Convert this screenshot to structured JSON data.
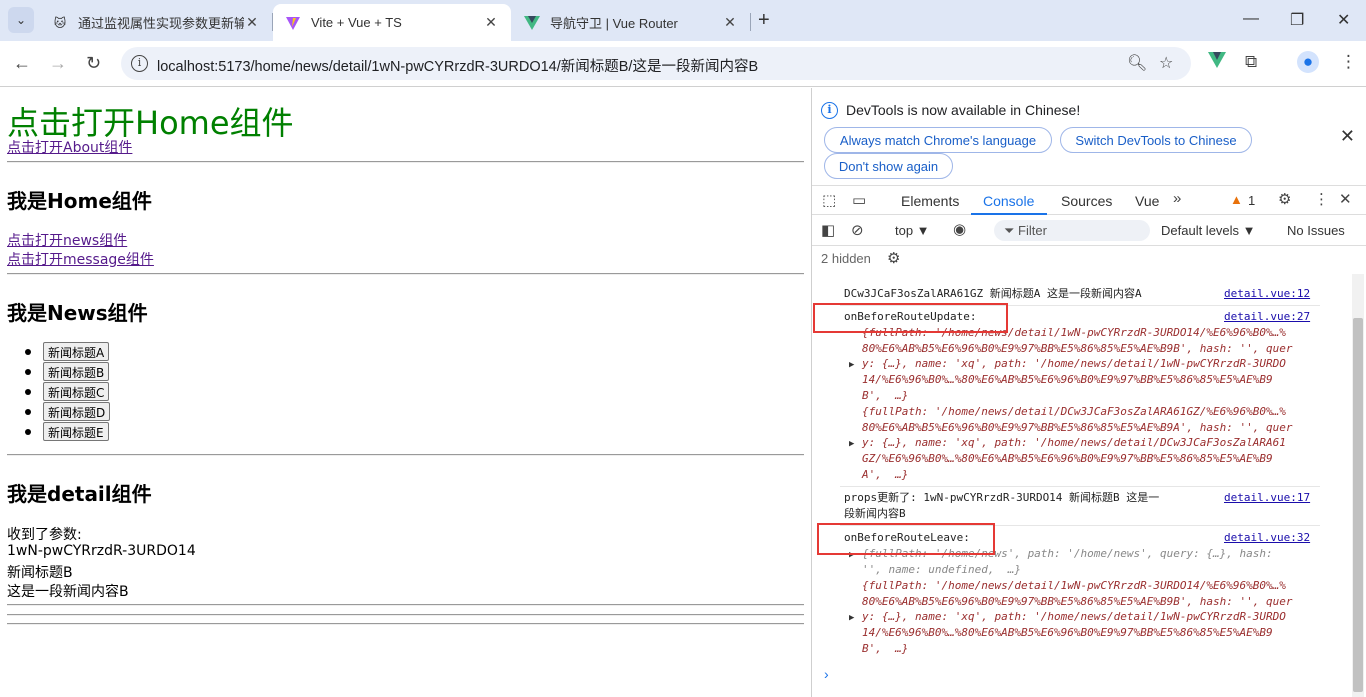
{
  "browser": {
    "tabs": [
      {
        "title": "通过监视属性实现参数更新输出",
        "icon": "chinese-site-favicon",
        "active": false
      },
      {
        "title": "Vite + Vue + TS",
        "icon": "vite-favicon",
        "active": true
      },
      {
        "title": "导航守卫 | Vue Router",
        "icon": "vue-favicon",
        "active": false
      }
    ],
    "url": "localhost:5173/home/news/detail/1wN-pwCYRrzdR-3URDO14/新闻标题B/这是一段新闻内容B"
  },
  "page": {
    "home_link_heading": "点击打开Home组件",
    "about_link": "点击打开About组件",
    "home_title": "我是Home组件",
    "news_link": "点击打开news组件",
    "message_link": "点击打开message组件",
    "news_title": "我是News组件",
    "news_items": [
      "新闻标题A",
      "新闻标题B",
      "新闻标题C",
      "新闻标题D",
      "新闻标题E"
    ],
    "detail_title": "我是detail组件",
    "received_label": "收到了参数:",
    "param_id": "1wN-pwCYRrzdR-3URDO14",
    "param_title": "新闻标题B",
    "param_content": "这是一段新闻内容B"
  },
  "devtools": {
    "infobar_message": "DevTools is now available in Chinese!",
    "btn_match": "Always match Chrome's language",
    "btn_switch": "Switch DevTools to Chinese",
    "btn_dont_show": "Don't show again",
    "tabs": [
      "Elements",
      "Console",
      "Sources",
      "Vue"
    ],
    "active_tab": "Console",
    "warning_count": "1",
    "context": "top ▼",
    "filter_placeholder": "Filter",
    "levels": "Default levels ▼",
    "issues": "No Issues",
    "hidden": "2 hidden",
    "logs": {
      "row1": "DCw3JCaF3osZalARA61GZ 新闻标题A 这是一段新闻内容A",
      "row1_src": "detail.vue:12",
      "update_label": "onBeforeRouteUpdate:",
      "update_src": "detail.vue:27",
      "u1": "{fullPath: '/home/news/detail/1wN-pwCYRrzdR-3URDO14/%E6%96%B0%…%",
      "u2": "80%E6%AB%B5%E6%96%B0%E9%97%BB%E5%86%85%E5%AE%B9B', hash: '', quer",
      "u3": "y: {…}, name: 'xq', path: '/home/news/detail/1wN-pwCYRrzdR-3URDO",
      "u4": "14/%E6%96%B0%…%80%E6%AB%B5%E6%96%B0%E9%97%BB%E5%86%85%E5%AE%B9",
      "u5": "B',  …}",
      "u6": "{fullPath: '/home/news/detail/DCw3JCaF3osZalARA61GZ/%E6%96%B0%…%",
      "u7": "80%E6%AB%B5%E6%96%B0%E9%97%BB%E5%86%85%E5%AE%B9A', hash: '', quer",
      "u8": "y: {…}, name: 'xq', path: '/home/news/detail/DCw3JCaF3osZalARA61",
      "u9": "GZ/%E6%96%B0%…%80%E6%AB%B5%E6%96%B0%E9%97%BB%E5%86%85%E5%AE%B9",
      "u10": "A',  …}",
      "props1": "props更新了: 1wN-pwCYRrzdR-3URDO14 新闻标题B 这是一",
      "props2": "段新闻内容B",
      "props_src": "detail.vue:17",
      "leave_label": "onBeforeRouteLeave:",
      "leave_src": "detail.vue:32",
      "l1": "{fullPath: '/home/news', path: '/home/news', query: {…}, hash:",
      "l2": "'', name: undefined,  …}",
      "l3": "{fullPath: '/home/news/detail/1wN-pwCYRrzdR-3URDO14/%E6%96%B0%…%",
      "l4": "80%E6%AB%B5%E6%96%B0%E9%97%BB%E5%86%85%E5%AE%B9B', hash: '', quer",
      "l5": "y: {…}, name: 'xq', path: '/home/news/detail/1wN-pwCYRrzdR-3URDO",
      "l6": "14/%E6%96%B0%…%80%E6%AB%B5%E6%96%B0%E9%97%BB%E5%86%85%E5%AE%B9",
      "l7": "B',  …}"
    }
  }
}
